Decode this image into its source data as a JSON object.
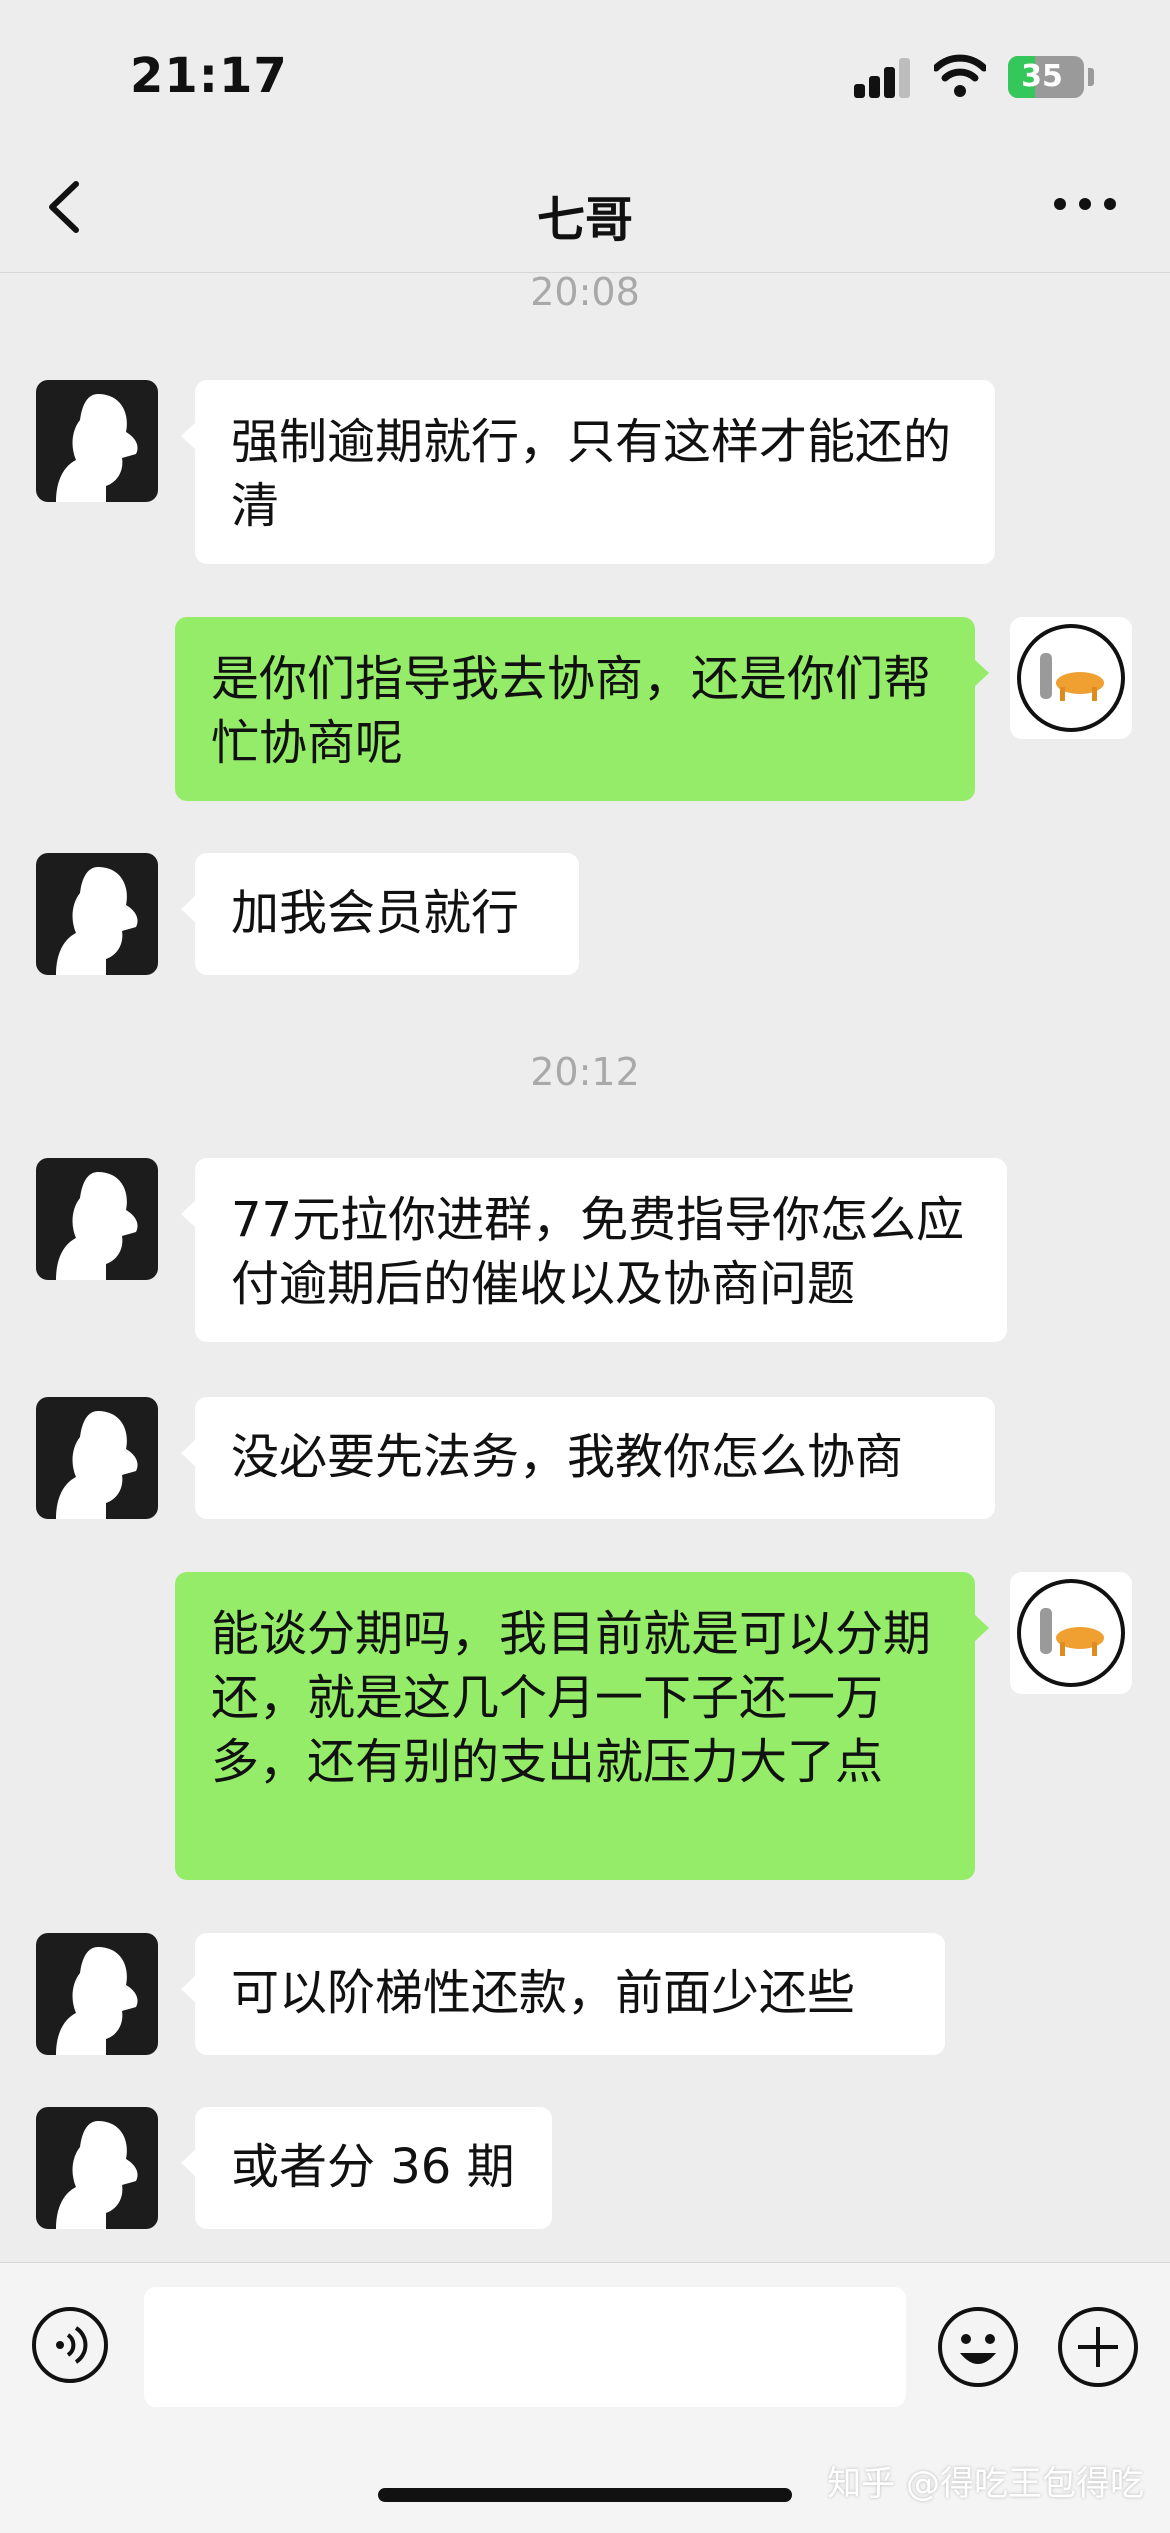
{
  "status_bar": {
    "time": "21:17",
    "battery": "35",
    "battery_fraction": 0.35
  },
  "header": {
    "title": "七哥"
  },
  "messages": [
    {
      "type": "time",
      "text": "20:08"
    },
    {
      "type": "msg",
      "from": "them",
      "text": "强制逾期就行，只有这样才能还的清"
    },
    {
      "type": "msg",
      "from": "me",
      "text": "是你们指导我去协商，还是你们帮忙协商呢"
    },
    {
      "type": "msg",
      "from": "them",
      "text": "加我会员就行"
    },
    {
      "type": "time",
      "text": "20:12"
    },
    {
      "type": "msg",
      "from": "them",
      "text": "77元拉你进群，免费指导你怎么应付逾期后的催收以及协商问题"
    },
    {
      "type": "msg",
      "from": "them",
      "text": "没必要先法务，我教你怎么协商"
    },
    {
      "type": "msg",
      "from": "me",
      "text": "能谈分期吗，我目前就是可以分期还，就是这几个月一下子还一万多，还有别的支出就压力大了点"
    },
    {
      "type": "msg",
      "from": "them",
      "text": "可以阶梯性还款，前面少还些"
    },
    {
      "type": "msg",
      "from": "them",
      "text": "或者分 36 期"
    }
  ],
  "watermark": "知乎 @得吃王包得吃",
  "colors": {
    "me_bubble": "#95ec69",
    "them_bubble": "#ffffff",
    "background": "#ededed"
  },
  "icons": [
    "back-icon",
    "more-icon",
    "voice-icon",
    "emoji-icon",
    "plus-icon"
  ]
}
